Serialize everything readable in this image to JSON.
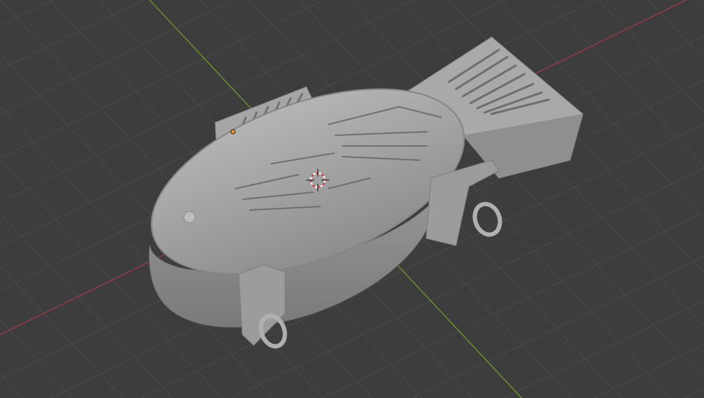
{
  "viewport": {
    "background": "#3d3d3d",
    "grid_color": "#4a4a4a",
    "x_axis_color": "#9b3a46",
    "y_axis_color": "#6a9a2a",
    "model_color": "#a7a7a7",
    "origin_color": "#ff9a1f"
  }
}
